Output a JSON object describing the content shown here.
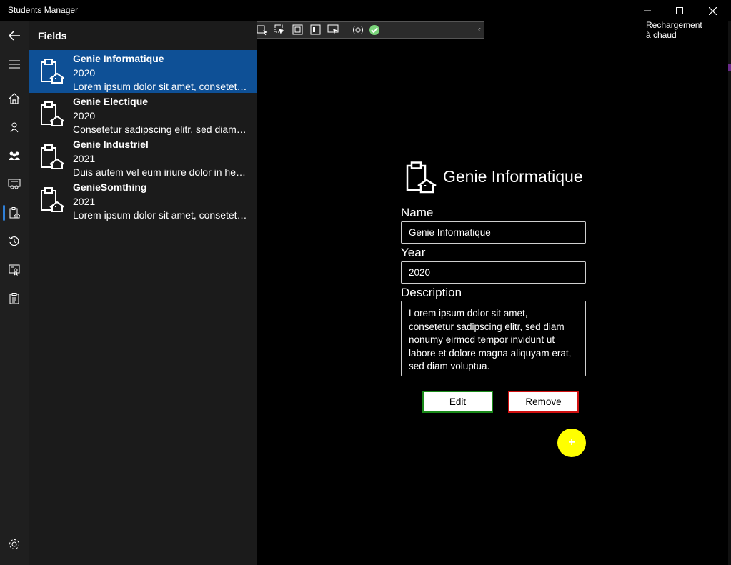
{
  "window": {
    "title": "Students Manager",
    "controls": [
      "minimize-icon",
      "maximize-icon",
      "close-icon"
    ]
  },
  "devtoolbar": {
    "buttons": [
      "live-visual-tree-icon",
      "select-element-icon",
      "display-layout-adorners-icon",
      "track-focus-icon",
      "preview-selection-icon",
      "binding-failures-icon"
    ],
    "hot_reload_label": "Rechargement à chaud"
  },
  "nav": {
    "back_icon": "back-arrow-icon",
    "menu_icon": "hamburger-menu-icon",
    "items": [
      "home-icon",
      "student-badge-icon",
      "people-group-icon",
      "classroom-icon",
      "fields-clipboard-icon",
      "history-icon",
      "certificate-icon",
      "clipboard-list-icon"
    ],
    "selected_index": 4,
    "settings_icon": "settings-gear-icon"
  },
  "list": {
    "heading": "Fields",
    "items": [
      {
        "name": "Genie Informatique",
        "year": "2020",
        "description": "Lorem ipsum dolor sit amet, consetetur sadipscing elitr, sed diam nonumy eirmod tempor invidunt ut labore et dolore magna aliquyam erat, sed diam voluptua.",
        "selected": true
      },
      {
        "name": "Genie Electique",
        "year": "2020",
        "description": "Consetetur sadipscing elitr, sed diam nonumy eirmod tempor invidunt ut labore",
        "selected": false
      },
      {
        "name": "Genie Industriel",
        "year": "2021",
        "description": "Duis autem vel eum iriure dolor in hendrerit in vulputate velit esse",
        "selected": false
      },
      {
        "name": "GenieSomthing",
        "year": "2021",
        "description": "Lorem ipsum dolor sit amet, consetetur sadipscing elitr",
        "selected": false
      }
    ]
  },
  "detail": {
    "title": "Genie Informatique",
    "name_label": "Name",
    "name_value": "Genie Informatique",
    "year_label": "Year",
    "year_value": "2020",
    "description_label": "Description",
    "description_value": "Lorem ipsum dolor sit amet,\nconsetetur sadipscing elitr, sed diam\nnonumy eirmod tempor invidunt ut\nlabore et dolore magna aliquyam erat,\nsed diam voluptua.",
    "edit_label": "Edit",
    "remove_label": "Remove",
    "add_label": "+"
  },
  "colors": {
    "accent_selected": "#0e5096",
    "edit_border": "#1a8a1a",
    "remove_border": "#d01010",
    "fab": "#ffff00"
  }
}
